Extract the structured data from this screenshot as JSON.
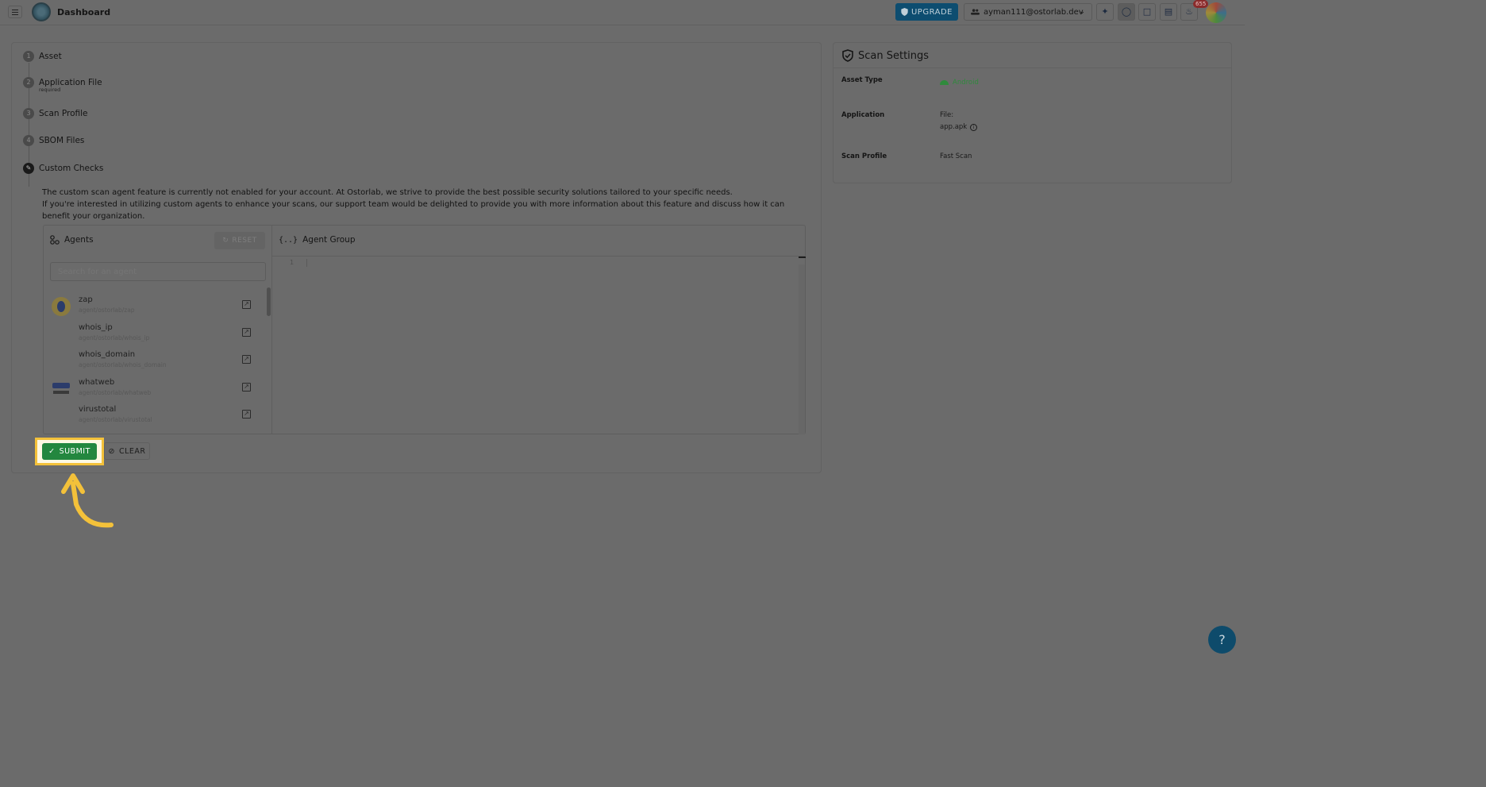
{
  "header": {
    "title": "Dashboard",
    "upgrade_label": "UPGRADE",
    "account_email": "ayman111@ostorlab.dev",
    "notification_count": "655"
  },
  "steps": [
    {
      "num": "1",
      "label": "Asset",
      "sub": ""
    },
    {
      "num": "2",
      "label": "Application File",
      "sub": "required"
    },
    {
      "num": "3",
      "label": "Scan Profile",
      "sub": ""
    },
    {
      "num": "4",
      "label": "SBOM Files",
      "sub": ""
    },
    {
      "num": "",
      "label": "Custom Checks",
      "sub": ""
    }
  ],
  "custom_checks": {
    "message_line1": "The custom scan agent feature is currently not enabled for your account. At Ostorlab, we strive to provide the best possible security solutions tailored to your specific needs.",
    "message_line2": "If you're interested in utilizing custom agents to enhance your scans, our support team would be delighted to provide you with more information about this feature and discuss how it can benefit your organization.",
    "agents_title": "Agents",
    "reset_label": "RESET",
    "search_placeholder": "Search for an agent",
    "agents": [
      {
        "name": "zap",
        "key": "agent/ostorlab/zap"
      },
      {
        "name": "whois_ip",
        "key": "agent/ostorlab/whois_ip"
      },
      {
        "name": "whois_domain",
        "key": "agent/ostorlab/whois_domain"
      },
      {
        "name": "whatweb",
        "key": "agent/ostorlab/whatweb"
      },
      {
        "name": "virustotal",
        "key": "agent/ostorlab/virustotal"
      }
    ],
    "agent_group_title": "Agent Group",
    "editor_line": "1"
  },
  "actions": {
    "submit_label": "SUBMIT",
    "clear_label": "CLEAR"
  },
  "scan_settings": {
    "title": "Scan Settings",
    "asset_type_label": "Asset Type",
    "asset_type_value": "Android",
    "application_label": "Application",
    "application_file_label": "File:",
    "application_file_value": "app.apk",
    "scan_profile_label": "Scan Profile",
    "scan_profile_value": "Fast Scan"
  },
  "help_label": "?",
  "colors": {
    "submit": "#23873f",
    "upgrade": "#0d4d70",
    "highlight": "#f3c13a",
    "android": "#3ddc84"
  }
}
